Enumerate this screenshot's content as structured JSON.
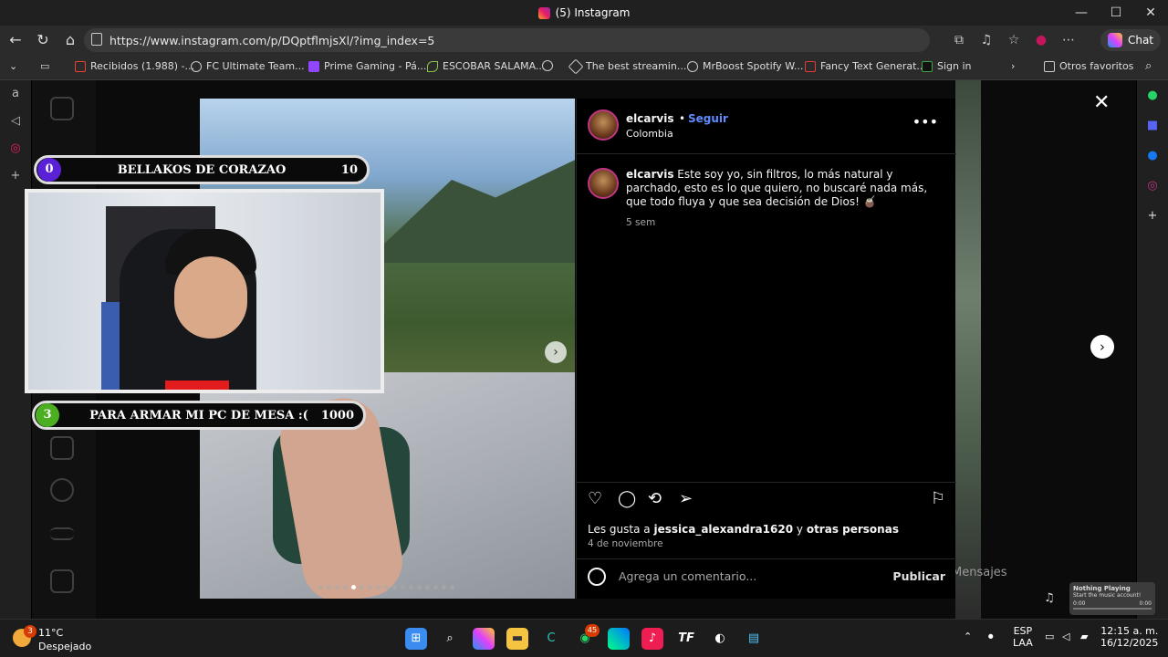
{
  "window": {
    "title": "(5) Instagram",
    "minimize": "—",
    "maximize": "☐",
    "close": "✕"
  },
  "browser": {
    "url": "https://www.instagram.com/p/DQptflmjsXl/?img_index=5",
    "chat_label": "Chat",
    "bookmarks": [
      {
        "label": "Recibidos (1.988) -...",
        "icon": "gmail-icon",
        "color": "#ea4335"
      },
      {
        "label": "FC Ultimate Team...",
        "icon": "globe-icon",
        "color": "#cccccc"
      },
      {
        "label": "Prime Gaming - Pá...",
        "icon": "prime-gaming-icon",
        "color": "#9146ff"
      },
      {
        "label": "ESCOBAR SALAMA...",
        "icon": "leaf-icon",
        "color": "#8bc34a"
      },
      {
        "label": "",
        "icon": "globe-icon",
        "color": "#cccccc"
      },
      {
        "label": "The best streamin...",
        "icon": "streaming-icon",
        "color": "#ffffff"
      },
      {
        "label": "MrBoost Spotify W...",
        "icon": "globe-icon",
        "color": "#cccccc"
      },
      {
        "label": "Fancy Text Generat...",
        "icon": "fancy-text-icon",
        "color": "#e53935"
      },
      {
        "label": "Sign in",
        "icon": "sat-icon",
        "color": "#43a047"
      }
    ],
    "other_favorites": "Otros favoritos"
  },
  "post": {
    "username": "elcarvis",
    "follow": "Seguir",
    "location": "Colombia",
    "caption": "Este soy yo, sin filtros, lo más natural y parchado, esto es lo que quiero, no buscaré nada más, que todo fluya y que sea decisión de Dios! 🧉",
    "age": "5 sem",
    "likes_prefix": "Les gusta a",
    "likes_user": "jessica_alexandra1620",
    "likes_and": "y",
    "likes_others": "otras personas",
    "date": "4 de noviembre",
    "comment_placeholder": "Agrega un comentario...",
    "publish": "Publicar",
    "carousel_count": 17,
    "carousel_index": 5
  },
  "background": {
    "messages_label": "Mensajes"
  },
  "stream_overlay": {
    "top_goal": {
      "number": "0",
      "label": "BELLAKOS DE CORAZAO",
      "target": "10",
      "color": "#5b21d6"
    },
    "bottom_goal": {
      "number": "3",
      "label": "PARA ARMAR MI PC DE MESA :(",
      "target": "1000",
      "color": "#4caf22"
    }
  },
  "now_playing": {
    "title": "Nothing Playing",
    "subtitle": "Start the music account!",
    "time_start": "0:00",
    "time_end": "0:00"
  },
  "taskbar": {
    "weather_temp": "11°C",
    "weather_desc": "Despejado",
    "weather_badge": "3",
    "whatsapp_badge": "45",
    "language": "ESP",
    "language_sub": "LAA",
    "time": "12:15 a. m.",
    "date": "16/12/2025"
  }
}
